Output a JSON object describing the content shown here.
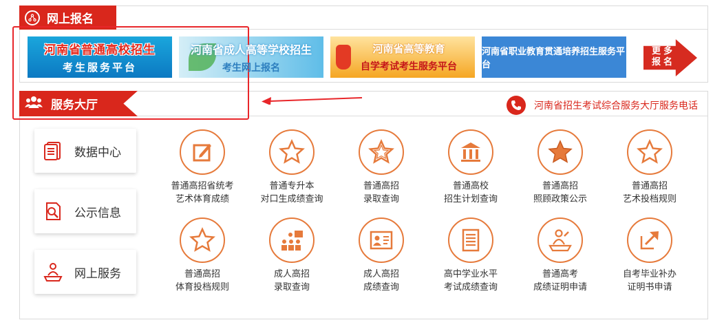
{
  "online": {
    "title": "网上报名",
    "banners": [
      {
        "line1": "河南省普通高校招生",
        "line2": "考生服务平台"
      },
      {
        "line1": "河南省成人高等学校招生",
        "line2": "考生网上报名"
      },
      {
        "line1": "河南省高等教育",
        "line2": "自学考试考生服务平台"
      },
      {
        "line1": "河南省职业教育贯通培养招生服务平台"
      }
    ],
    "more_label": "更多报名"
  },
  "service": {
    "title": "服务大厅",
    "hotline": "河南省招生考试综合服务大厅服务电话",
    "side": [
      {
        "label": "数据中心",
        "icon": "document-stack-icon"
      },
      {
        "label": "公示信息",
        "icon": "search-document-icon"
      },
      {
        "label": "网上服务",
        "icon": "person-desk-icon"
      }
    ],
    "items": [
      {
        "line1": "普通高招省统考",
        "line2": "艺术体育成绩",
        "icon": "edit-form-icon"
      },
      {
        "line1": "普通专升本",
        "line2": "对口生成绩查询",
        "icon": "star-outline-icon"
      },
      {
        "line1": "普通高招",
        "line2": "录取查询",
        "icon": "star-outline-icon"
      },
      {
        "line1": "普通高校",
        "line2": "招生计划查询",
        "icon": "institution-icon"
      },
      {
        "line1": "普通高招",
        "line2": "照顾政策公示",
        "icon": "star-filled-icon"
      },
      {
        "line1": "普通高招",
        "line2": "艺术投档规则",
        "icon": "star-outline-icon"
      },
      {
        "line1": "普通高招",
        "line2": "体育投档规则",
        "icon": "star-outline-icon"
      },
      {
        "line1": "成人高招",
        "line2": "录取查询",
        "icon": "presentation-group-icon"
      },
      {
        "line1": "成人高招",
        "line2": "成绩查询",
        "icon": "id-card-icon"
      },
      {
        "line1": "高中学业水平",
        "line2": "考试成绩查询",
        "icon": "document-lines-icon"
      },
      {
        "line1": "普通高考",
        "line2": "成绩证明申请",
        "icon": "person-desk-icon"
      },
      {
        "line1": "自考毕业补办",
        "line2": "证明书申请",
        "icon": "share-arrow-icon"
      }
    ]
  },
  "colors": {
    "brand_red": "#d9271c",
    "icon_orange": "#e67a3b",
    "annotation_red": "#e8262a"
  }
}
